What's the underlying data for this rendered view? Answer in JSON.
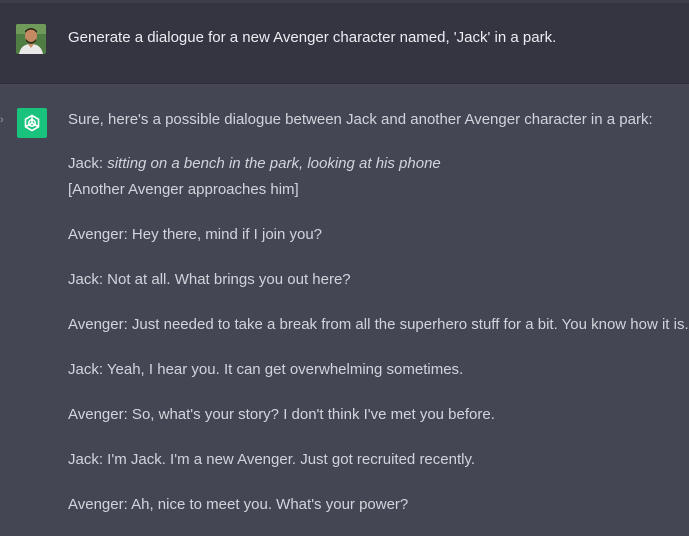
{
  "conversation": {
    "user_message": "Generate a dialogue for a new Avenger character named, 'Jack' in a park.",
    "assistant": {
      "intro": "Sure, here's a possible dialogue between Jack and another Avenger character in a park:",
      "line1_speaker": "Jack: ",
      "line1_action": "sitting on a bench in the park, looking at his phone",
      "line2": "[Another Avenger approaches him]",
      "line3": "Avenger: Hey there, mind if I join you?",
      "line4": "Jack: Not at all. What brings you out here?",
      "line5": "Avenger: Just needed to take a break from all the superhero stuff for a bit. You know how it is.",
      "line6": "Jack: Yeah, I hear you. It can get overwhelming sometimes.",
      "line7": "Avenger: So, what's your story? I don't think I've met you before.",
      "line8": "Jack: I'm Jack. I'm a new Avenger. Just got recruited recently.",
      "line9": "Avenger: Ah, nice to meet you. What's your power?"
    }
  },
  "icons": {
    "user_avatar": "user-avatar-photo",
    "assistant_avatar": "openai-logo-icon",
    "left_marker": "chevron-right-icon"
  },
  "colors": {
    "user_row_bg": "#343541",
    "assistant_row_bg": "#444654",
    "assistant_icon_bg": "#19c37d",
    "text": "#d1d5db"
  }
}
